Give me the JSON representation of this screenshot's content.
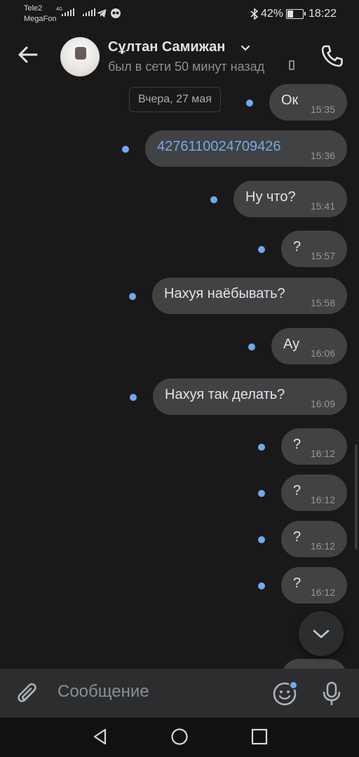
{
  "status_bar": {
    "carrier1": "Tele2",
    "carrier2": "MegaFon",
    "network": "4G",
    "battery": "42%",
    "battery_level": 0.42,
    "time": "18:22"
  },
  "header": {
    "name": "Сұлтан Самижан",
    "last_seen": "был в сети 50 минут назад"
  },
  "chat": {
    "date_chip": "Вчера, 27 мая",
    "messages": [
      {
        "text": "Ок",
        "time": "15:35",
        "unread": true
      },
      {
        "text": "4276110024709426",
        "time": "15:36",
        "unread": true
      },
      {
        "text": "Ну что?",
        "time": "15:41",
        "unread": true
      },
      {
        "text": "?",
        "time": "15:57",
        "unread": true
      },
      {
        "text": "Нахуя наёбывать?",
        "time": "15:58",
        "unread": true
      },
      {
        "text": "Ау",
        "time": "16:06",
        "unread": true
      },
      {
        "text": "Нахуя так делать?",
        "time": "16:09",
        "unread": true
      },
      {
        "text": "?",
        "time": "16:12",
        "unread": true
      },
      {
        "text": "?",
        "time": "16:12",
        "unread": true
      },
      {
        "text": "?",
        "time": "16:12",
        "unread": true
      },
      {
        "text": "?",
        "time": "16:12",
        "unread": true
      },
      {
        "text": "?",
        "time": "",
        "unread": true
      }
    ]
  },
  "composer": {
    "placeholder": "Сообщение"
  },
  "colors": {
    "background": "#19191a",
    "bubble": "#414243",
    "accent": "#71aaeb",
    "secondary_text": "#8b8f94"
  }
}
